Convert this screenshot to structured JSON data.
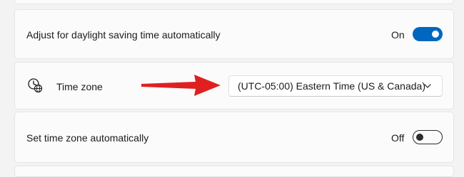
{
  "daylight_saving": {
    "label": "Adjust for daylight saving time automatically",
    "state": "On"
  },
  "time_zone": {
    "label": "Time zone",
    "selected": "(UTC-05:00) Eastern Time (US & Canada)",
    "icon": "clock-globe-icon"
  },
  "auto_time_zone": {
    "label": "Set time zone automatically",
    "state": "Off"
  },
  "colors": {
    "accent": "#0067c0",
    "arrow": "#e02020",
    "background": "#f3f3f3",
    "card": "#fbfbfb"
  }
}
